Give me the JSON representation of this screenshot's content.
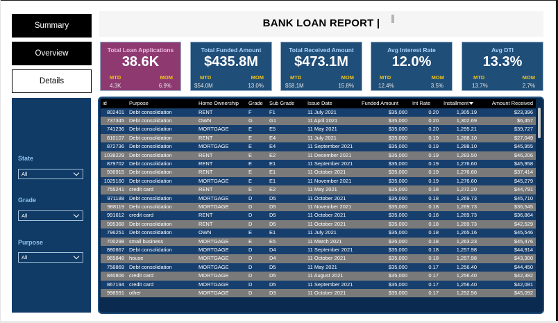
{
  "nav": {
    "summary": "Summary",
    "overview": "Overview",
    "details": "Details"
  },
  "header": {
    "title": "BANK LOAN REPORT |"
  },
  "kpis": [
    {
      "title": "Total Loan Applications",
      "value": "38.6K",
      "mtd_label": "MTD",
      "mom_label": "MOM",
      "mtd": "4.3K",
      "mom": "6.9%"
    },
    {
      "title": "Total Funded Amount",
      "value": "$435.8M",
      "mtd_label": "MTD",
      "mom_label": "MOM",
      "mtd": "$54.0M",
      "mom": "13.0%"
    },
    {
      "title": "Total Received Amount",
      "value": "$473.1M",
      "mtd_label": "MTD",
      "mom_label": "MOM",
      "mtd": "$58.1M",
      "mom": "15.8%"
    },
    {
      "title": "Avg Interest Rate",
      "value": "12.0%",
      "mtd_label": "MTD",
      "mom_label": "MOM",
      "mtd": "12.4%",
      "mom": "3.5%"
    },
    {
      "title": "Avg DTI",
      "value": "13.3%",
      "mtd_label": "MTD",
      "mom_label": "MOM",
      "mtd": "13.7%",
      "mom": "2.7%"
    }
  ],
  "filters": {
    "state": {
      "label": "State",
      "value": "All"
    },
    "grade": {
      "label": "Grade",
      "value": "All"
    },
    "purpose": {
      "label": "Purpose",
      "value": "All"
    }
  },
  "table": {
    "columns": [
      "id",
      "Purpose",
      "Home Ownership",
      "Grade",
      "Sub Grade",
      "Issue Date",
      "Funded Amount",
      "Int Rate",
      "Installment",
      "Amount Received"
    ],
    "rows": [
      [
        "802401",
        "Debt consolidation",
        "RENT",
        "F",
        "F1",
        "11 July 2021",
        "$35,000",
        "0.20",
        "1,305.19",
        "$23,396"
      ],
      [
        "737345",
        "Debt consolidation",
        "OWN",
        "G",
        "G1",
        "11 April 2021",
        "$35,000",
        "0.20",
        "1,302.69",
        "$6,457"
      ],
      [
        "741236",
        "Debt consolidation",
        "MORTGAGE",
        "E",
        "E5",
        "11 May 2021",
        "$35,000",
        "0.20",
        "1,295.21",
        "$39,727"
      ],
      [
        "810107",
        "Debt consolidation",
        "RENT",
        "E",
        "E4",
        "11 July 2021",
        "$35,000",
        "0.19",
        "1,288.10",
        "$27,049"
      ],
      [
        "872736",
        "Debt consolidation",
        "MORTGAGE",
        "E",
        "E4",
        "11 September 2021",
        "$35,000",
        "0.19",
        "1,288.10",
        "$45,955"
      ],
      [
        "1038229",
        "Debt consolidation",
        "RENT",
        "E",
        "E2",
        "11 December 2021",
        "$35,000",
        "0.19",
        "1,283.50",
        "$46,206"
      ],
      [
        "879702",
        "Debt consolidation",
        "RENT",
        "E",
        "E1",
        "11 September 2021",
        "$35,000",
        "0.19",
        "1,276.60",
        "$45,958"
      ],
      [
        "936915",
        "Debt consolidation",
        "RENT",
        "E",
        "E1",
        "11 October 2021",
        "$35,000",
        "0.19",
        "1,276.60",
        "$37,414"
      ],
      [
        "1025160",
        "Debt consolidation",
        "MORTGAGE",
        "E",
        "E1",
        "11 November 2021",
        "$35,000",
        "0.19",
        "1,276.60",
        "$45,279"
      ],
      [
        "755241",
        "credit card",
        "RENT",
        "E",
        "E2",
        "11 May 2021",
        "$35,000",
        "0.18",
        "1,272.20",
        "$44,791"
      ],
      [
        "971188",
        "Debt consolidation",
        "MORTGAGE",
        "D",
        "D5",
        "11 October 2021",
        "$35,000",
        "0.18",
        "1,269.73",
        "$45,710"
      ],
      [
        "988119",
        "Debt consolidation",
        "MORTGAGE",
        "D",
        "D5",
        "11 November 2021",
        "$35,000",
        "0.18",
        "1,269.73",
        "$36,545"
      ],
      [
        "991612",
        "credit card",
        "RENT",
        "D",
        "D5",
        "11 October 2021",
        "$35,000",
        "0.18",
        "1,269.73",
        "$36,864"
      ],
      [
        "995368",
        "Debt consolidation",
        "RENT",
        "D",
        "D5",
        "11 October 2021",
        "$35,000",
        "0.18",
        "1,269.73",
        "$42,529"
      ],
      [
        "796251",
        "Debt consolidation",
        "OWN",
        "E",
        "E1",
        "11 July 2021",
        "$35,000",
        "0.18",
        "1,265.16",
        "$45,546"
      ],
      [
        "700298",
        "small business",
        "MORTGAGE",
        "E",
        "E5",
        "11 March 2021",
        "$35,000",
        "0.18",
        "1,263.23",
        "$45,476"
      ],
      [
        "880667",
        "Debt consolidation",
        "MORTGAGE",
        "D",
        "D4",
        "11 September 2021",
        "$35,000",
        "0.18",
        "1,257.98",
        "$44,914"
      ],
      [
        "965848",
        "house",
        "MORTGAGE",
        "D",
        "D4",
        "11 October 2021",
        "$35,000",
        "0.18",
        "1,257.98",
        "$43,300"
      ],
      [
        "758869",
        "Debt consolidation",
        "MORTGAGE",
        "D",
        "D5",
        "11 May 2021",
        "$35,000",
        "0.17",
        "1,256.40",
        "$44,450"
      ],
      [
        "840806",
        "credit card",
        "MORTGAGE",
        "D",
        "D5",
        "11 August 2021",
        "$35,000",
        "0.17",
        "1,256.40",
        "$42,382"
      ],
      [
        "867194",
        "credit card",
        "MORTGAGE",
        "D",
        "D5",
        "11 September 2021",
        "$35,000",
        "0.17",
        "1,256.40",
        "$42,081"
      ],
      [
        "998591",
        "other",
        "MORTGAGE",
        "D",
        "D3",
        "11 October 2021",
        "$35,000",
        "0.17",
        "1,252.56",
        "$45,092"
      ]
    ]
  },
  "colors": {
    "kpi_primary": "#1f4e79",
    "kpi_accent": "#8e3a71",
    "row_odd": "#173f6e",
    "row_even": "#7a7a7a",
    "mtd_mom_label": "#f0c419"
  },
  "icons": {
    "sort": "sort-descending-icon",
    "dropdown": "chevron-down-icon"
  }
}
